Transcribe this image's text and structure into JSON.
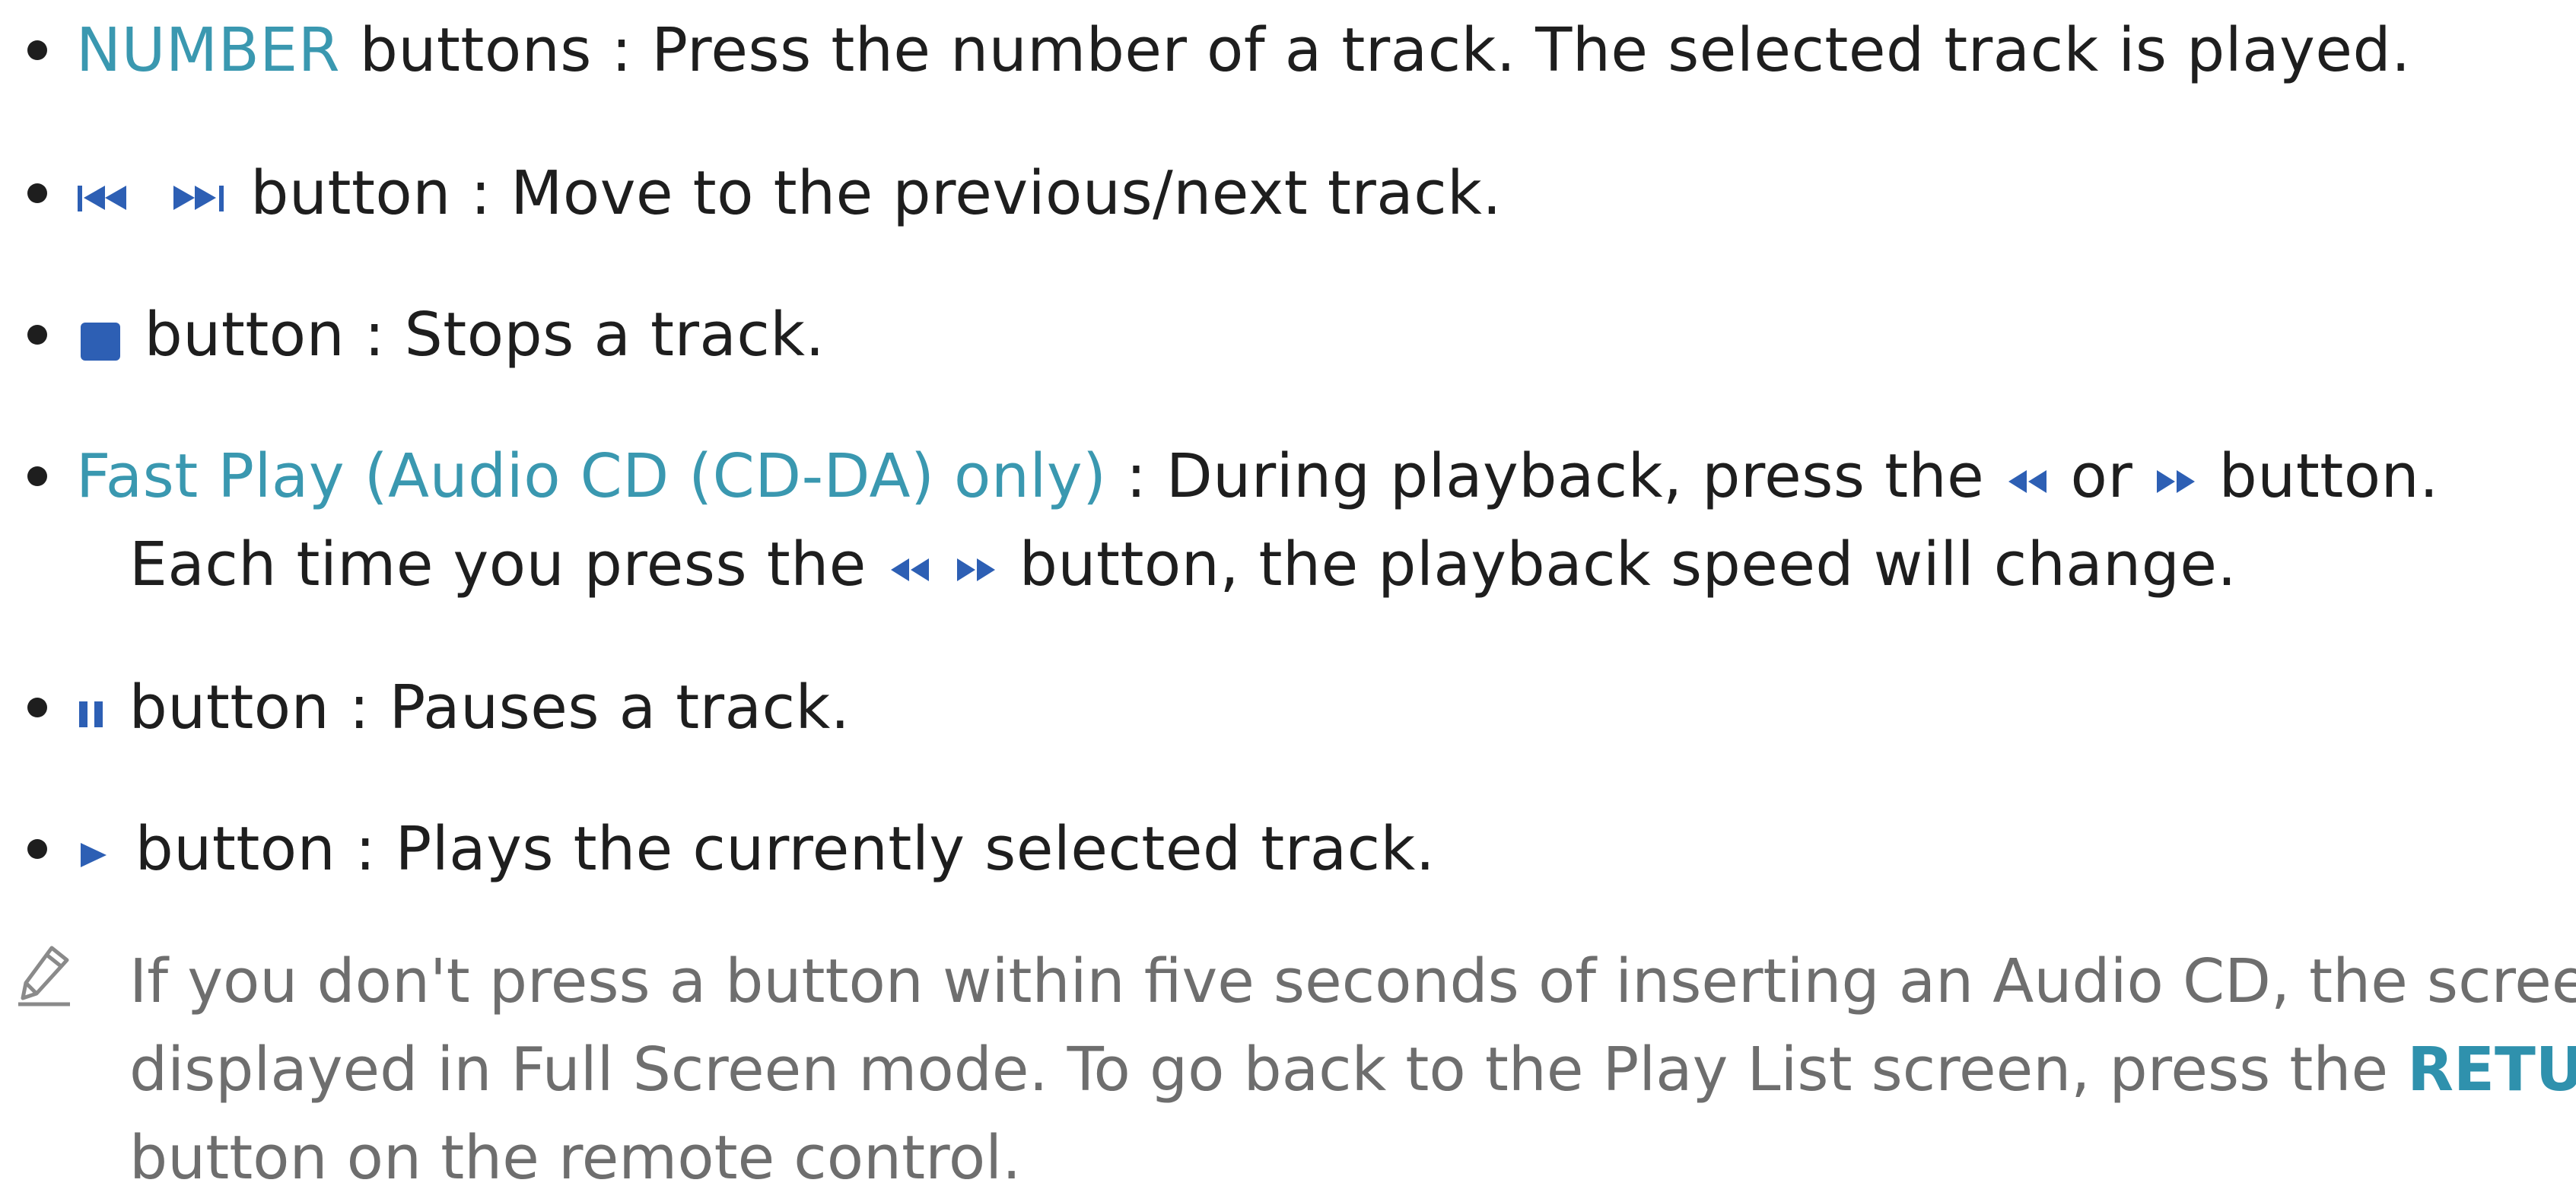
{
  "items": [
    {
      "label": "NUMBER",
      "label_word": "buttons",
      "sep": ":",
      "text": "Press the number of a track. The selected track is played."
    },
    {
      "icons": [
        "skip-previous-icon",
        "skip-next-icon"
      ],
      "label_word": "button",
      "sep": ":",
      "text": "Move to the previous/next track."
    },
    {
      "icons": [
        "stop-icon"
      ],
      "label_word": "button",
      "sep": ":",
      "text": "Stops a track."
    },
    {
      "label": "Fast Play (Audio CD (CD-DA) only)",
      "sep": ":",
      "text_a": "During playback, press the",
      "text_or": "or",
      "text_b": "button.",
      "line2_a": "Each time you press the",
      "line2_b": "button, the playback speed will change.",
      "icons": [
        "rewind-icon",
        "fast-forward-icon"
      ]
    },
    {
      "icons": [
        "pause-icon"
      ],
      "label_word": "button",
      "sep": ":",
      "text": "Pauses a track."
    },
    {
      "icons": [
        "play-icon"
      ],
      "label_word": "button",
      "sep": ":",
      "text": "Plays the currently selected track."
    }
  ],
  "note": {
    "icon": "pencil-icon",
    "line1": "If you don't press a button within five seconds of inserting an Audio CD, the screen is",
    "line2_a": "displayed in Full Screen mode. To go back to the Play List screen, press the",
    "line2_key": "RETURN",
    "line3": "button on the remote control."
  },
  "colors": {
    "accent_text": "#3a98b0",
    "icon_blue": "#2d5fb4",
    "body_text": "#1e1e1e",
    "note_text": "#6e6e6e"
  }
}
